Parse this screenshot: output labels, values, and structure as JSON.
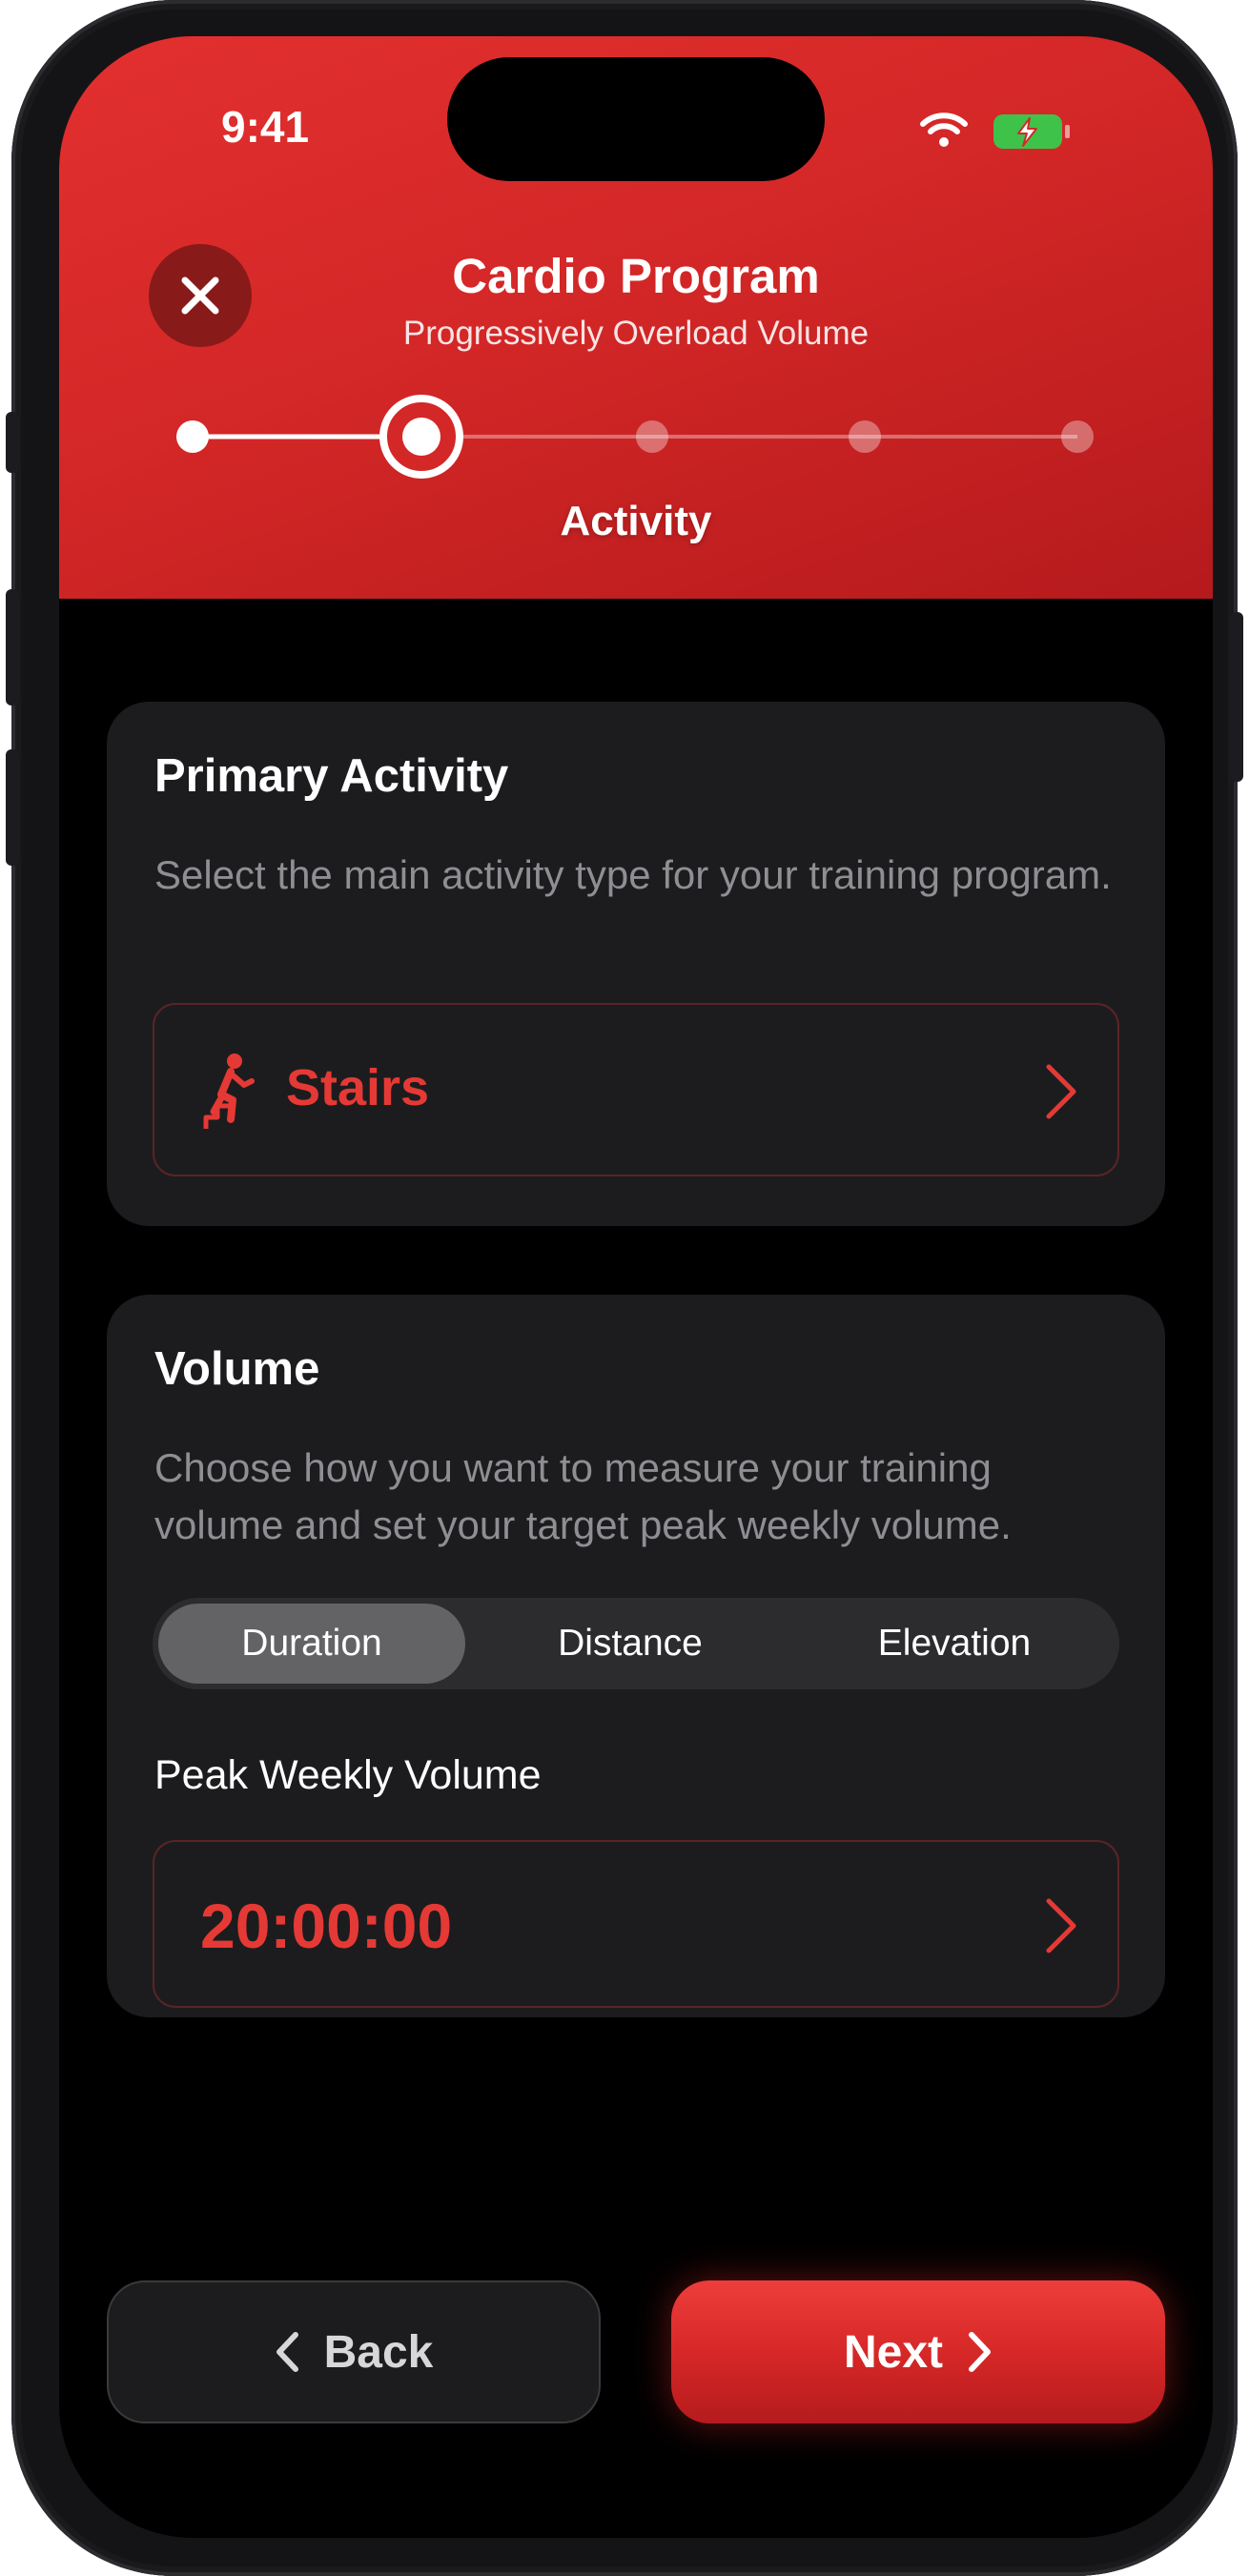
{
  "status_bar": {
    "time": "9:41",
    "wifi_icon": "wifi-icon",
    "battery_icon": "battery-charging-icon"
  },
  "header": {
    "title": "Cardio Program",
    "subtitle": "Progressively Overload Volume",
    "close_icon": "close-icon",
    "current_step_label": "Activity",
    "steps_total": 5,
    "current_step": 2
  },
  "primary_activity": {
    "title": "Primary Activity",
    "description": "Select the main activity type for your training program.",
    "selected_value": "Stairs",
    "activity_icon": "stairs-climber-icon"
  },
  "volume": {
    "title": "Volume",
    "description": "Choose how you want to measure your training volume and set your target peak weekly volume.",
    "segments": [
      "Duration",
      "Distance",
      "Elevation"
    ],
    "selected_segment": "Duration",
    "peak_label": "Peak Weekly Volume",
    "peak_value": "20:00:00"
  },
  "footer": {
    "back_label": "Back",
    "next_label": "Next"
  },
  "colors": {
    "accent": "#e53935",
    "header": "#d42727",
    "card": "#1c1c1e",
    "muted_text": "#8e8e93"
  }
}
